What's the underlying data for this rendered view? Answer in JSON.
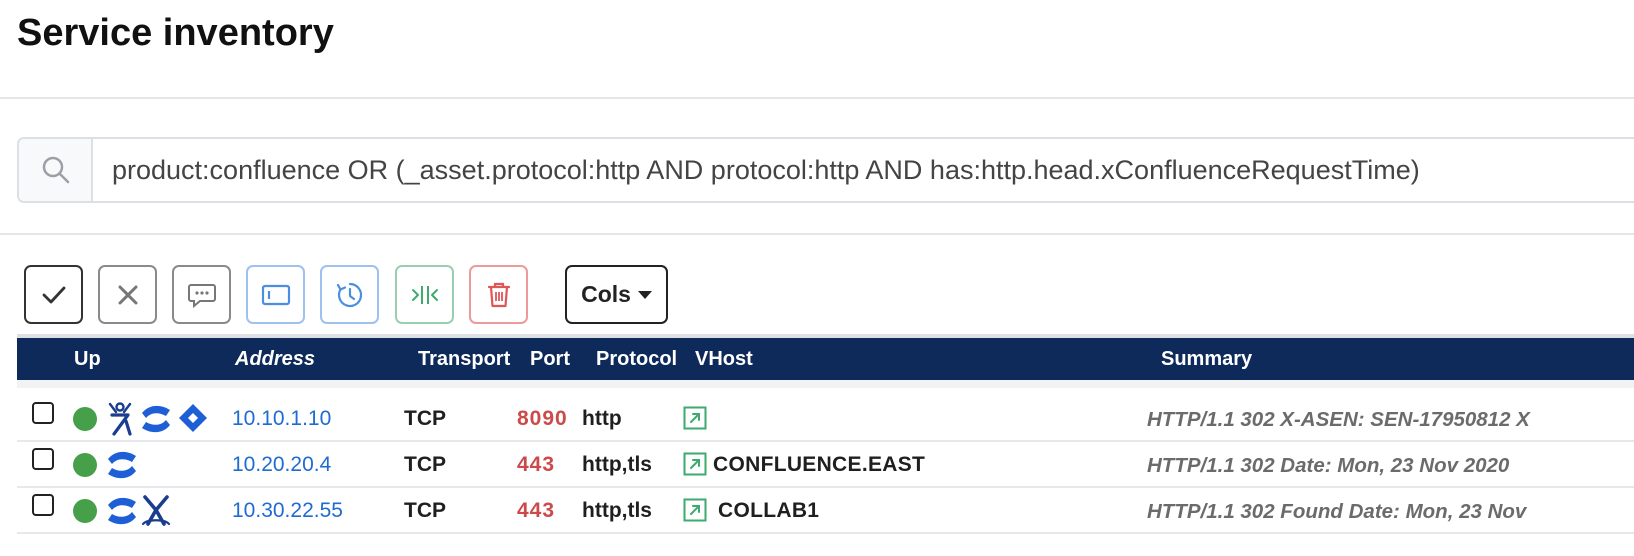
{
  "page": {
    "title": "Service inventory"
  },
  "search": {
    "query": "product:confluence OR (_asset.protocol:http AND protocol:http AND has:http.head.xConfluenceRequestTime)",
    "icon": "search-icon"
  },
  "toolbar": {
    "buttons": [
      {
        "name": "confirm-button",
        "icon": "check-icon",
        "color": "#333333"
      },
      {
        "name": "reject-button",
        "icon": "close-icon",
        "color": "#8a8a8a"
      },
      {
        "name": "comment-button",
        "icon": "comment-icon",
        "color": "#8a8a8a"
      },
      {
        "name": "view-button",
        "icon": "window-icon",
        "color": "#4a8fe0"
      },
      {
        "name": "history-button",
        "icon": "history-icon",
        "color": "#4a8fe0"
      },
      {
        "name": "merge-button",
        "icon": "merge-icon",
        "color": "#3daa6e"
      },
      {
        "name": "delete-button",
        "icon": "trash-icon",
        "color": "#e05555"
      }
    ],
    "cols_label": "Cols"
  },
  "table": {
    "header_bg": "#0e2a5a",
    "columns": {
      "up": "Up",
      "address": "Address",
      "transport": "Transport",
      "port": "Port",
      "protocol": "Protocol",
      "vhost": "VHost",
      "summary": "Summary"
    },
    "rows": [
      {
        "up_status": "up",
        "products": [
          "jira-service-desk-icon",
          "confluence-icon",
          "jira-icon"
        ],
        "address": "10.10.1.10",
        "transport": "TCP",
        "port": "8090",
        "protocol": "http",
        "vhost": "",
        "summary": "HTTP/1.1 302 X-ASEN: SEN-17950812 X"
      },
      {
        "up_status": "up",
        "products": [
          "confluence-icon"
        ],
        "address": "10.20.20.4",
        "transport": "TCP",
        "port": "443",
        "protocol": "http,tls",
        "vhost": "CONFLUENCE.EAST",
        "summary": "HTTP/1.1 302 Date: Mon, 23 Nov 2020"
      },
      {
        "up_status": "up",
        "products": [
          "confluence-icon",
          "jira-software-icon"
        ],
        "address": "10.30.22.55",
        "transport": "TCP",
        "port": "443",
        "protocol": "http,tls",
        "vhost": "COLLAB1",
        "summary": "HTTP/1.1 302 Found Date: Mon, 23 Nov"
      }
    ]
  },
  "colors": {
    "up_green": "#46a049",
    "link_blue": "#1f6bd2",
    "port_red": "#cc4a4a",
    "vhost_link_green": "#3daa6e",
    "atlassian_blue": "#1f5fd6"
  }
}
